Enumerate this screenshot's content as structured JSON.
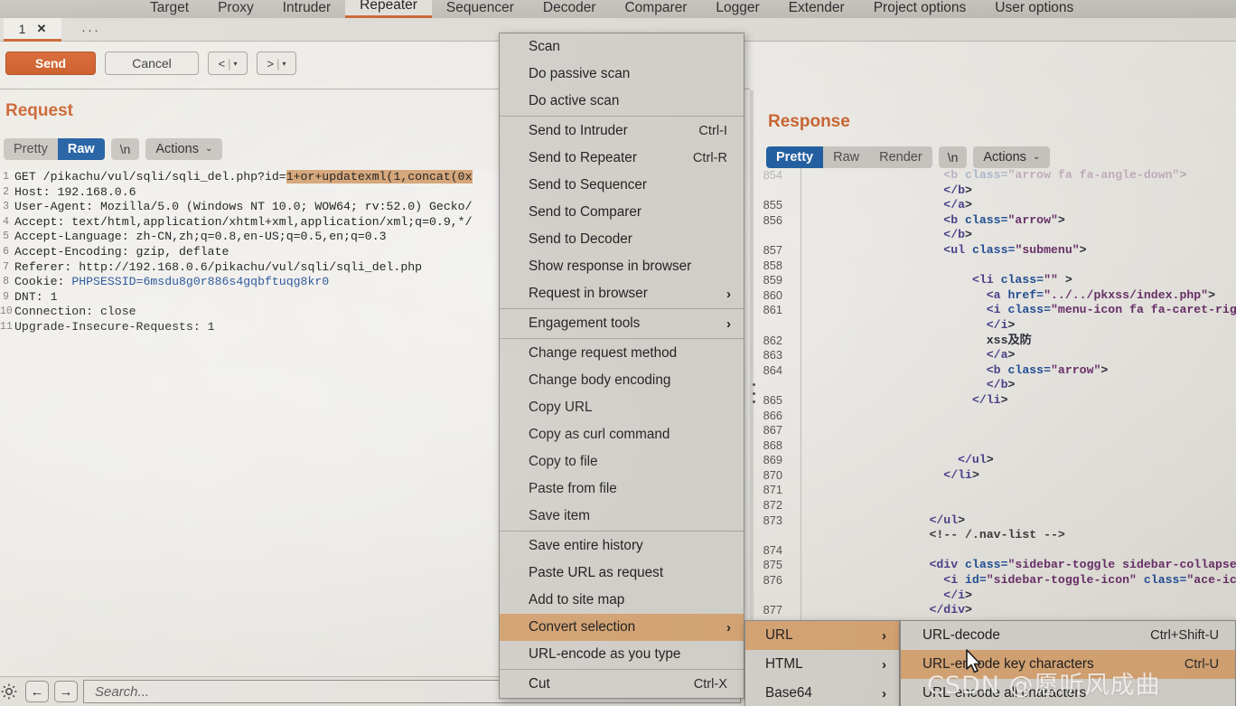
{
  "app": {
    "top_tabs": [
      {
        "label": "Target",
        "active": false
      },
      {
        "label": "Proxy",
        "active": false
      },
      {
        "label": "Intruder",
        "active": false
      },
      {
        "label": "Repeater",
        "active": true
      },
      {
        "label": "Sequencer",
        "active": false
      },
      {
        "label": "Decoder",
        "active": false
      },
      {
        "label": "Comparer",
        "active": false
      },
      {
        "label": "Logger",
        "active": false
      },
      {
        "label": "Extender",
        "active": false
      },
      {
        "label": "Project options",
        "active": false
      },
      {
        "label": "User options",
        "active": false
      }
    ],
    "session_tab": {
      "label": "1",
      "close": "✕",
      "add": "···"
    }
  },
  "toolbar": {
    "send_label": "Send",
    "cancel_label": "Cancel",
    "back_label": "<",
    "forward_label": ">",
    "dropdown_caret": "▾",
    "separator": "|"
  },
  "request": {
    "title": "Request",
    "views": [
      {
        "label": "Pretty",
        "selected": false
      },
      {
        "label": "Raw",
        "selected": true
      }
    ],
    "newline_label": "\\n",
    "actions_label": "Actions",
    "actions_caret": "⌄",
    "lines": [
      {
        "n": "1",
        "pre": "GET /pikachu/vul/sqli/sqli_del.php?id=",
        "sel": "1+or+updatexml(1,concat(0x",
        "post": ""
      },
      {
        "n": "2",
        "pre": "Host: 192.168.0.6",
        "sel": "",
        "post": ""
      },
      {
        "n": "3",
        "pre": "User-Agent: Mozilla/5.0 (Windows NT 10.0; WOW64; rv:52.0) Gecko/",
        "sel": "",
        "post": ""
      },
      {
        "n": "4",
        "pre": "Accept: text/html,application/xhtml+xml,application/xml;q=0.9,*/",
        "sel": "",
        "post": ""
      },
      {
        "n": "5",
        "pre": "Accept-Language: zh-CN,zh;q=0.8,en-US;q=0.5,en;q=0.3",
        "sel": "",
        "post": ""
      },
      {
        "n": "6",
        "pre": "Accept-Encoding: gzip, deflate",
        "sel": "",
        "post": ""
      },
      {
        "n": "7",
        "pre": "Referer: http://192.168.0.6/pikachu/vul/sqli/sqli_del.php",
        "sel": "",
        "post": ""
      },
      {
        "n": "8",
        "pre": "Cookie: ",
        "sel": "",
        "post": "PHPSESSID=6msdu8g0r886s4gqbftuqg8kr0",
        "cookie": true
      },
      {
        "n": "9",
        "pre": "DNT: 1",
        "sel": "",
        "post": ""
      },
      {
        "n": "10",
        "pre": "Connection: close",
        "sel": "",
        "post": ""
      },
      {
        "n": "11",
        "pre": "Upgrade-Insecure-Requests: 1",
        "sel": "",
        "post": ""
      }
    ]
  },
  "response": {
    "title": "Response",
    "views": [
      {
        "label": "Pretty",
        "selected": true
      },
      {
        "label": "Raw",
        "selected": false
      },
      {
        "label": "Render",
        "selected": false
      }
    ],
    "newline_label": "\\n",
    "actions_label": "Actions",
    "actions_caret": "⌄",
    "lines": [
      {
        "n": "854",
        "text": "                    <b class=\"arrow fa fa-angle-down\">",
        "faded": true
      },
      {
        "n": "",
        "text": "                    </b>"
      },
      {
        "n": "855",
        "text": "                    </a>"
      },
      {
        "n": "856",
        "text": "                    <b class=\"arrow\">"
      },
      {
        "n": "",
        "text": "                    </b>"
      },
      {
        "n": "857",
        "text": "                    <ul class=\"submenu\">"
      },
      {
        "n": "858",
        "text": ""
      },
      {
        "n": "859",
        "text": "                        <li class=\"\" >"
      },
      {
        "n": "860",
        "text": "                          <a href=\"../../pkxss/index.php\">"
      },
      {
        "n": "861",
        "text": "                          <i class=\"menu-icon fa fa-caret-right\">"
      },
      {
        "n": "",
        "text": "                          </i>"
      },
      {
        "n": "862",
        "text": "                          xss及防"
      },
      {
        "n": "863",
        "text": "                          </a>"
      },
      {
        "n": "864",
        "text": "                          <b class=\"arrow\">"
      },
      {
        "n": "",
        "text": "                          </b>"
      },
      {
        "n": "865",
        "text": "                        </li>"
      },
      {
        "n": "866",
        "text": ""
      },
      {
        "n": "867",
        "text": ""
      },
      {
        "n": "868",
        "text": ""
      },
      {
        "n": "869",
        "text": "                      </ul>"
      },
      {
        "n": "870",
        "text": "                    </li>"
      },
      {
        "n": "871",
        "text": ""
      },
      {
        "n": "872",
        "text": ""
      },
      {
        "n": "873",
        "text": "                  </ul>"
      },
      {
        "n": "",
        "text": "                  <!-- /.nav-list -->"
      },
      {
        "n": "874",
        "text": ""
      },
      {
        "n": "875",
        "text": "                  <div class=\"sidebar-toggle sidebar-collapse\" i"
      },
      {
        "n": "876",
        "text": "                    <i id=\"sidebar-toggle-icon\" class=\"ace-icon"
      },
      {
        "n": "",
        "text": "                    </i>"
      },
      {
        "n": "877",
        "text": "                  </div>"
      }
    ]
  },
  "context_menu": {
    "groups": [
      {
        "items": [
          {
            "label": "Scan",
            "accel": "",
            "arrow": false,
            "highlighted": false
          },
          {
            "label": "Do passive scan",
            "accel": "",
            "arrow": false,
            "highlighted": false
          },
          {
            "label": "Do active scan",
            "accel": "",
            "arrow": false,
            "highlighted": false
          }
        ]
      },
      {
        "items": [
          {
            "label": "Send to Intruder",
            "accel": "Ctrl-I",
            "arrow": false,
            "highlighted": false
          },
          {
            "label": "Send to Repeater",
            "accel": "Ctrl-R",
            "arrow": false,
            "highlighted": false
          },
          {
            "label": "Send to Sequencer",
            "accel": "",
            "arrow": false,
            "highlighted": false
          },
          {
            "label": "Send to Comparer",
            "accel": "",
            "arrow": false,
            "highlighted": false
          },
          {
            "label": "Send to Decoder",
            "accel": "",
            "arrow": false,
            "highlighted": false
          },
          {
            "label": "Show response in browser",
            "accel": "",
            "arrow": false,
            "highlighted": false
          },
          {
            "label": "Request in browser",
            "accel": "",
            "arrow": true,
            "highlighted": false
          }
        ]
      },
      {
        "items": [
          {
            "label": "Engagement tools",
            "accel": "",
            "arrow": true,
            "highlighted": false
          }
        ]
      },
      {
        "items": [
          {
            "label": "Change request method",
            "accel": "",
            "arrow": false,
            "highlighted": false
          },
          {
            "label": "Change body encoding",
            "accel": "",
            "arrow": false,
            "highlighted": false
          },
          {
            "label": "Copy URL",
            "accel": "",
            "arrow": false,
            "highlighted": false
          },
          {
            "label": "Copy as curl command",
            "accel": "",
            "arrow": false,
            "highlighted": false
          },
          {
            "label": "Copy to file",
            "accel": "",
            "arrow": false,
            "highlighted": false
          },
          {
            "label": "Paste from file",
            "accel": "",
            "arrow": false,
            "highlighted": false
          },
          {
            "label": "Save item",
            "accel": "",
            "arrow": false,
            "highlighted": false
          }
        ]
      },
      {
        "items": [
          {
            "label": "Save entire history",
            "accel": "",
            "arrow": false,
            "highlighted": false
          },
          {
            "label": "Paste URL as request",
            "accel": "",
            "arrow": false,
            "highlighted": false
          },
          {
            "label": "Add to site map",
            "accel": "",
            "arrow": false,
            "highlighted": false
          },
          {
            "label": "Convert selection",
            "accel": "",
            "arrow": true,
            "highlighted": true
          },
          {
            "label": "URL-encode as you type",
            "accel": "",
            "arrow": false,
            "highlighted": false
          }
        ]
      },
      {
        "items": [
          {
            "label": "Cut",
            "accel": "Ctrl-X",
            "arrow": false,
            "highlighted": false
          }
        ]
      }
    ]
  },
  "submenu_convert": {
    "items": [
      {
        "label": "URL",
        "arrow": true,
        "highlighted": true
      },
      {
        "label": "HTML",
        "arrow": true,
        "highlighted": false
      },
      {
        "label": "Base64",
        "arrow": true,
        "highlighted": false
      }
    ]
  },
  "submenu_url": {
    "items": [
      {
        "label": "URL-decode",
        "accel": "Ctrl+Shift-U",
        "highlighted": false
      },
      {
        "label": "URL-encode key characters",
        "accel": "Ctrl-U",
        "highlighted": true
      },
      {
        "label": "URL-encode all characters",
        "accel": "",
        "highlighted": false
      }
    ]
  },
  "bottom": {
    "gear_icon": "gear-icon",
    "back_label": "←",
    "forward_label": "→",
    "search_placeholder": "Search..."
  },
  "watermark": {
    "text": "CSDN @愿听风成曲"
  },
  "colors": {
    "accent_orange": "#d2622a",
    "menu_highlight": "#d9a36f",
    "selection_highlight": "#d9a574",
    "tab_selected_blue": "#1b5fa8",
    "send_button": "#d2581f"
  }
}
